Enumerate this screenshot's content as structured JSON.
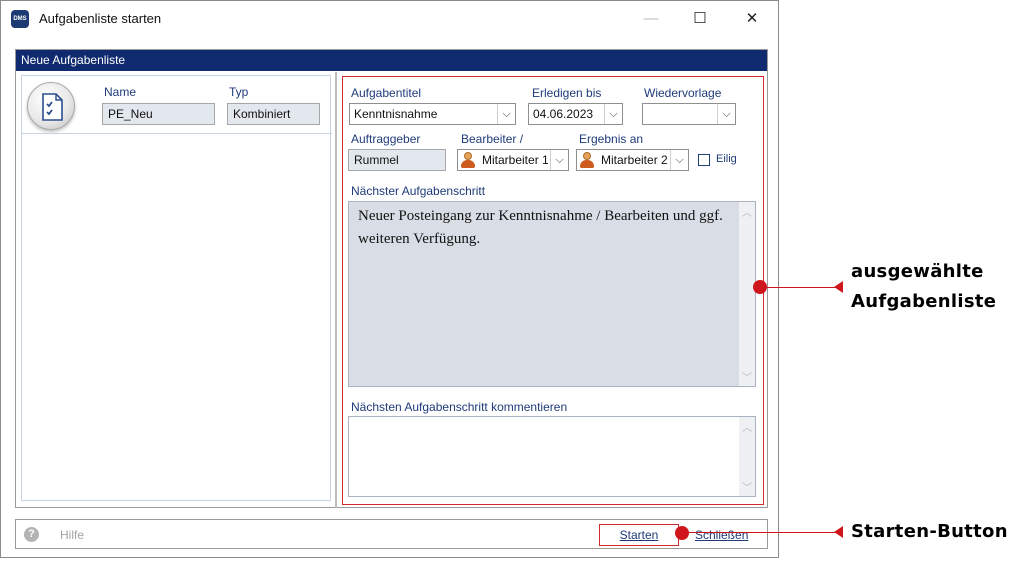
{
  "window": {
    "title": "Aufgabenliste starten",
    "app_icon_text": "DMS",
    "minimize_glyph": "—",
    "maximize_glyph": "☐",
    "close_glyph": "✕"
  },
  "panel": {
    "header": "Neue Aufgabenliste"
  },
  "left": {
    "name_label": "Name",
    "name_value": "PE_Neu",
    "type_label": "Typ",
    "type_value": "Kombiniert"
  },
  "form": {
    "aufgabentitel_label": "Aufgabentitel",
    "aufgabentitel_value": "Kenntnisnahme",
    "erledigen_label": "Erledigen bis",
    "erledigen_value": "04.06.2023",
    "wiedervorlage_label": "Wiedervorlage",
    "wiedervorlage_value": "",
    "auftraggeber_label": "Auftraggeber",
    "auftraggeber_value": "Rummel",
    "bearbeiter_label": "Bearbeiter /",
    "bearbeiter_value": "Mitarbeiter 1",
    "ergebnis_label": "Ergebnis an",
    "ergebnis_value": "Mitarbeiter 2",
    "eilig_label": "Eilig",
    "eilig_checked": false,
    "naechster_label": "Nächster Aufgabenschritt",
    "naechster_text": "Neuer Posteingang zur Kenntnisnahme / Bearbeiten und ggf. weiteren Verfügung.",
    "kommentar_label": "Nächsten Aufgabenschritt kommentieren",
    "kommentar_value": "",
    "scroll_up_glyph": "︿",
    "scroll_down_glyph": "﹀"
  },
  "footer": {
    "help_glyph": "?",
    "help_label": "Hilfe",
    "start_label": "Starten",
    "close_label": "Schließen"
  },
  "annotations": {
    "list_line1": "ausgewählte",
    "list_line2": "Aufgabenliste",
    "start_label": "Starten-Button"
  },
  "colors": {
    "header_bg": "#0f2a6e",
    "label_blue": "#1f3b7a",
    "highlight_red": "#d12b2b"
  }
}
